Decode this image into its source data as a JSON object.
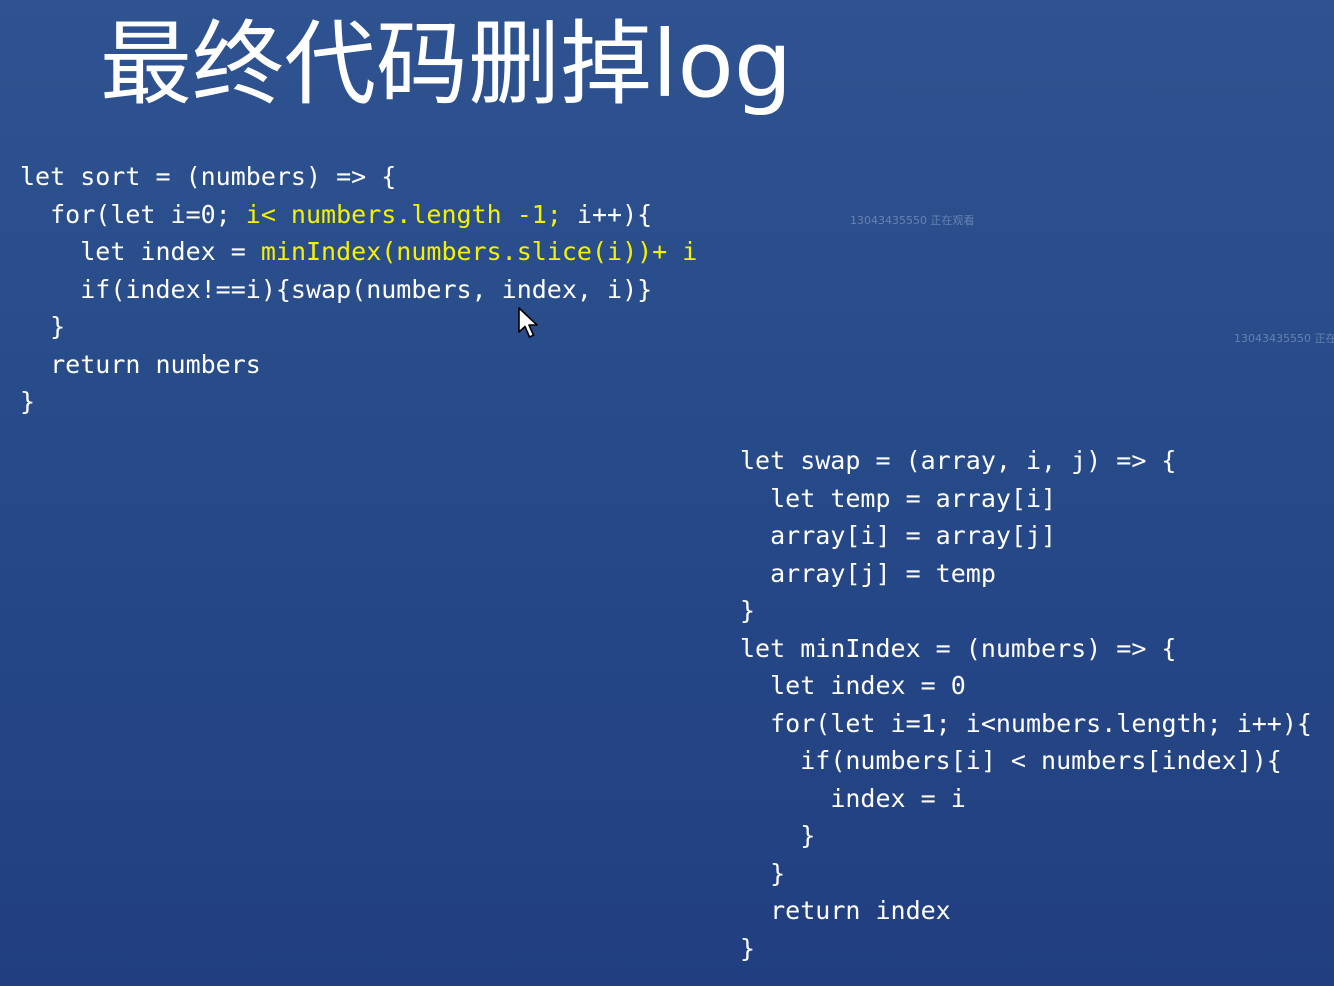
{
  "slide": {
    "title": "最终代码删掉log"
  },
  "code": {
    "sort": {
      "lines": [
        {
          "indent": "",
          "segments": [
            {
              "text": "let sort = (numbers) => {",
              "hl": false
            }
          ]
        },
        {
          "indent": "  ",
          "segments": [
            {
              "text": "for(let i=0; ",
              "hl": false
            },
            {
              "text": "i< numbers.length -1;",
              "hl": true
            },
            {
              "text": " i++){",
              "hl": false
            }
          ]
        },
        {
          "indent": "    ",
          "segments": [
            {
              "text": "let index = ",
              "hl": false
            },
            {
              "text": "minIndex(numbers.slice(i))+ i",
              "hl": true
            }
          ]
        },
        {
          "indent": "    ",
          "segments": [
            {
              "text": "if(index!==i){swap(numbers, index, i)}",
              "hl": false
            }
          ]
        },
        {
          "indent": "  ",
          "segments": [
            {
              "text": "}",
              "hl": false
            }
          ]
        },
        {
          "indent": "  ",
          "segments": [
            {
              "text": "return numbers",
              "hl": false
            }
          ]
        },
        {
          "indent": "",
          "segments": [
            {
              "text": "}",
              "hl": false
            }
          ]
        }
      ]
    },
    "helpers": {
      "lines": [
        {
          "indent": "",
          "segments": [
            {
              "text": "let swap = (array, i, j) => {",
              "hl": false
            }
          ]
        },
        {
          "indent": "  ",
          "segments": [
            {
              "text": "let temp = array[i]",
              "hl": false
            }
          ]
        },
        {
          "indent": "  ",
          "segments": [
            {
              "text": "array[i] = array[j]",
              "hl": false
            }
          ]
        },
        {
          "indent": "  ",
          "segments": [
            {
              "text": "array[j] = temp",
              "hl": false
            }
          ]
        },
        {
          "indent": "",
          "segments": [
            {
              "text": "}",
              "hl": false
            }
          ]
        },
        {
          "indent": "",
          "segments": [
            {
              "text": "let minIndex = (numbers) => {",
              "hl": false
            }
          ]
        },
        {
          "indent": "  ",
          "segments": [
            {
              "text": "let index = 0",
              "hl": false
            }
          ]
        },
        {
          "indent": "  ",
          "segments": [
            {
              "text": "for(let i=1; i<numbers.length; i++){",
              "hl": false
            }
          ]
        },
        {
          "indent": "    ",
          "segments": [
            {
              "text": "if(numbers[i] < numbers[index]){",
              "hl": false
            }
          ]
        },
        {
          "indent": "      ",
          "segments": [
            {
              "text": "index = i",
              "hl": false
            }
          ]
        },
        {
          "indent": "    ",
          "segments": [
            {
              "text": "}",
              "hl": false
            }
          ]
        },
        {
          "indent": "  ",
          "segments": [
            {
              "text": "}",
              "hl": false
            }
          ]
        },
        {
          "indent": "  ",
          "segments": [
            {
              "text": "return index",
              "hl": false
            }
          ]
        },
        {
          "indent": "",
          "segments": [
            {
              "text": "}",
              "hl": false
            }
          ]
        }
      ]
    }
  },
  "watermarks": [
    "13043435550 正在观看",
    "13043435550 正在"
  ],
  "colors": {
    "background_top": "#2f5390",
    "background_bottom": "#213f80",
    "code_text": "#ffffff",
    "highlight": "#f6f100"
  },
  "icons": {
    "cursor": "mouse-pointer-icon"
  }
}
